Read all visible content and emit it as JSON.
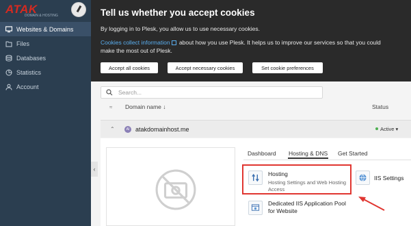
{
  "sidebar": {
    "logo_text": "ATAK",
    "logo_sub": "DOMAIN & HOSTING",
    "items": [
      {
        "label": "Websites & Domains",
        "icon": "monitor-icon",
        "active": true
      },
      {
        "label": "Files",
        "icon": "folder-icon"
      },
      {
        "label": "Databases",
        "icon": "database-icon"
      },
      {
        "label": "Statistics",
        "icon": "statistics-icon"
      },
      {
        "label": "Account",
        "icon": "account-icon"
      }
    ],
    "collapse_glyph": "‹"
  },
  "cookie_banner": {
    "title": "Tell us whether you accept cookies",
    "line1": "By logging in to Plesk, you allow us to use necessary cookies.",
    "link_text": "Cookies collect information",
    "line2_rest": " about how you use Plesk. It helps us to improve our services so that you could make the most out of Plesk.",
    "buttons": [
      "Accept all cookies",
      "Accept necessary cookies",
      "Set cookie preferences"
    ]
  },
  "search": {
    "placeholder": "Search..."
  },
  "table": {
    "collapse_all": "≈",
    "col_domain": "Domain name ↓",
    "col_status": "Status"
  },
  "domain": {
    "name": "atakdomainhost.me",
    "favicon_letters": "AI",
    "status": "Active ▾",
    "status_color": "#4caf50"
  },
  "tabs": [
    "Dashboard",
    "Hosting & DNS",
    "Get Started"
  ],
  "selected_tab": "Hosting & DNS",
  "tiles": {
    "hosting": {
      "title": "Hosting",
      "subtitle": "Hosting Settings and Web Hosting Access"
    },
    "iis": {
      "title": "IIS Settings"
    },
    "pool": {
      "title": "Dedicated IIS Application Pool for Website"
    }
  },
  "colors": {
    "sidebar_bg": "#2b3e50",
    "banner_bg": "#2a2a2a",
    "highlight": "#e03530",
    "link": "#5aaeef"
  }
}
